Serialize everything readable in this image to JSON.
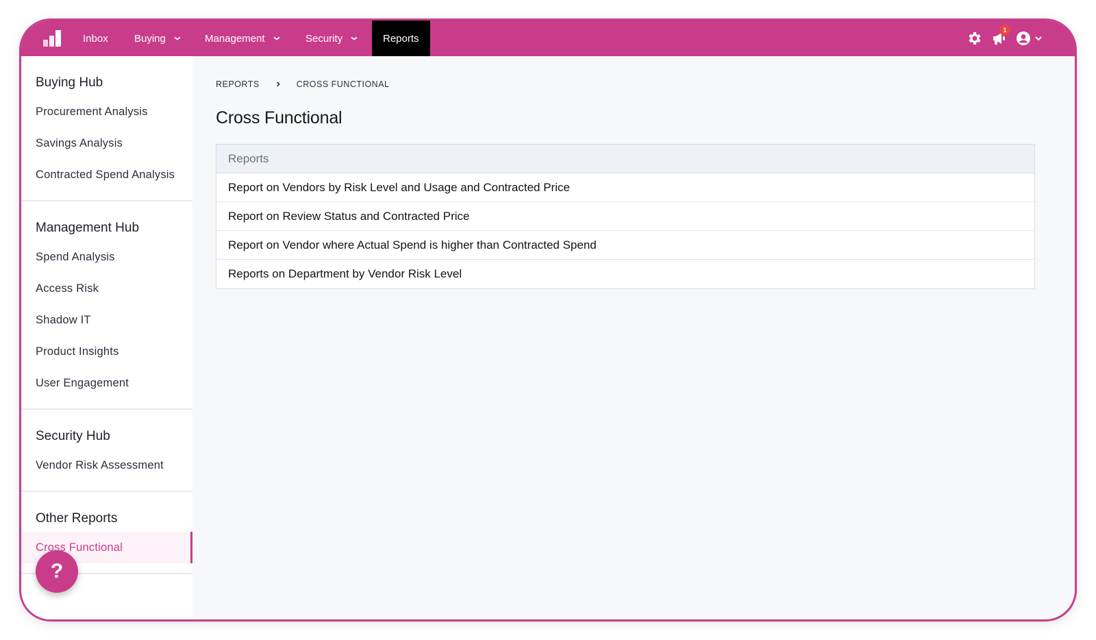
{
  "nav": {
    "items": [
      {
        "label": "Inbox"
      },
      {
        "label": "Buying"
      },
      {
        "label": "Management"
      },
      {
        "label": "Security"
      },
      {
        "label": "Reports"
      }
    ],
    "notification_count": "1",
    "icons": [
      "logo-icon",
      "gear-icon",
      "megaphone-icon",
      "user-avatar-icon",
      "chevron-down-icon"
    ]
  },
  "sidebar": {
    "sections": [
      {
        "title": "Buying Hub",
        "items": [
          "Procurement Analysis",
          "Savings Analysis",
          "Contracted Spend Analysis"
        ]
      },
      {
        "title": "Management Hub",
        "items": [
          "Spend Analysis",
          "Access Risk",
          "Shadow IT",
          "Product Insights",
          "User Engagement"
        ]
      },
      {
        "title": "Security Hub",
        "items": [
          "Vendor Risk Assessment"
        ]
      },
      {
        "title": "Other Reports",
        "items": [
          "Cross Functional"
        ]
      }
    ],
    "help_label": "?"
  },
  "breadcrumb": {
    "root": "REPORTS",
    "current": "CROSS FUNCTIONAL"
  },
  "page": {
    "title": "Cross Functional"
  },
  "reports_table": {
    "header": "Reports",
    "rows": [
      "Report on Vendors by Risk Level and Usage and Contracted Price",
      "Report on Review Status and Contracted Price",
      "Report on Vendor where Actual Spend is higher than Contracted Spend",
      "Reports on Department by Vendor Risk Level"
    ]
  },
  "colors": {
    "brand": "#c93c8a",
    "active_nav": "#000000",
    "badge": "#ef4444"
  }
}
